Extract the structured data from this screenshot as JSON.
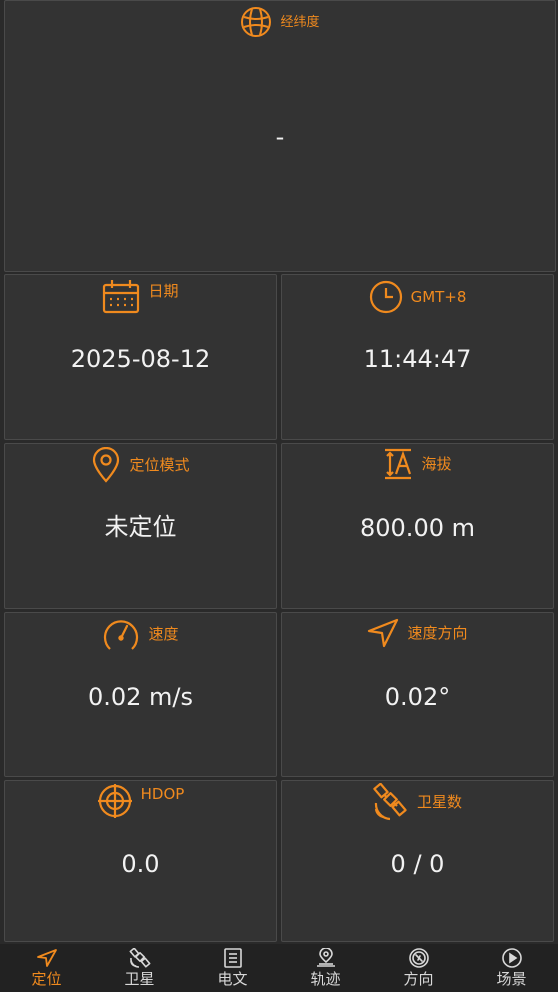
{
  "colors": {
    "accent": "#f08a1e",
    "background": "#2a2a2a",
    "card": "#333333",
    "text": "#f2f2f2"
  },
  "cards": {
    "coordinates": {
      "title": "经纬度",
      "value": "-",
      "icon": "globe-icon"
    },
    "date": {
      "title": "日期",
      "value": "2025-08-12",
      "icon": "calendar-icon"
    },
    "time": {
      "title": "GMT+8",
      "value": "11:44:47",
      "icon": "clock-icon"
    },
    "mode": {
      "title": "定位模式",
      "value": "未定位",
      "icon": "location-pin-icon"
    },
    "altitude": {
      "title": "海拔",
      "value": "800.00 m",
      "icon": "altitude-icon"
    },
    "speed": {
      "title": "速度",
      "value": "0.02 m/s",
      "icon": "speedometer-icon"
    },
    "heading": {
      "title": "速度方向",
      "value": "0.02°",
      "icon": "navigation-arrow-icon"
    },
    "hdop": {
      "title": "HDOP",
      "value": "0.0",
      "icon": "crosshair-icon"
    },
    "satellites": {
      "title": "卫星数",
      "value": "0 / 0",
      "icon": "satellite-icon"
    }
  },
  "nav": {
    "items": [
      {
        "label": "定位",
        "icon": "navigation-arrow-icon",
        "active": true
      },
      {
        "label": "卫星",
        "icon": "satellite-icon",
        "active": false
      },
      {
        "label": "电文",
        "icon": "document-icon",
        "active": false
      },
      {
        "label": "轨迹",
        "icon": "map-pin-icon",
        "active": false
      },
      {
        "label": "方向",
        "icon": "compass-icon",
        "active": false
      },
      {
        "label": "场景",
        "icon": "play-icon",
        "active": false
      }
    ]
  }
}
